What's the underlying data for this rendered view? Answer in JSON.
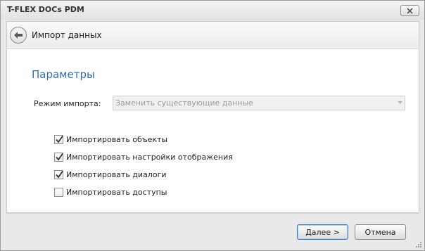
{
  "window": {
    "title": "T-FLEX DOCs PDM",
    "close_icon": "close-icon"
  },
  "header": {
    "back_icon": "arrow-left-icon",
    "title": "Импорт данных"
  },
  "section": {
    "title": "Параметры"
  },
  "import_mode": {
    "label": "Режим импорта:",
    "value": "Заменить существующие данные",
    "enabled": false
  },
  "options": [
    {
      "label": "Импортировать объекты",
      "checked": true
    },
    {
      "label": "Импортировать настройки отображения",
      "checked": true
    },
    {
      "label": "Импортировать диалоги",
      "checked": true
    },
    {
      "label": "Импортировать доступы",
      "checked": false
    }
  ],
  "buttons": {
    "next": "Далее >",
    "cancel": "Отмена"
  },
  "colors": {
    "accent": "#2f6fad",
    "disabled_text": "#9c9c9c"
  }
}
